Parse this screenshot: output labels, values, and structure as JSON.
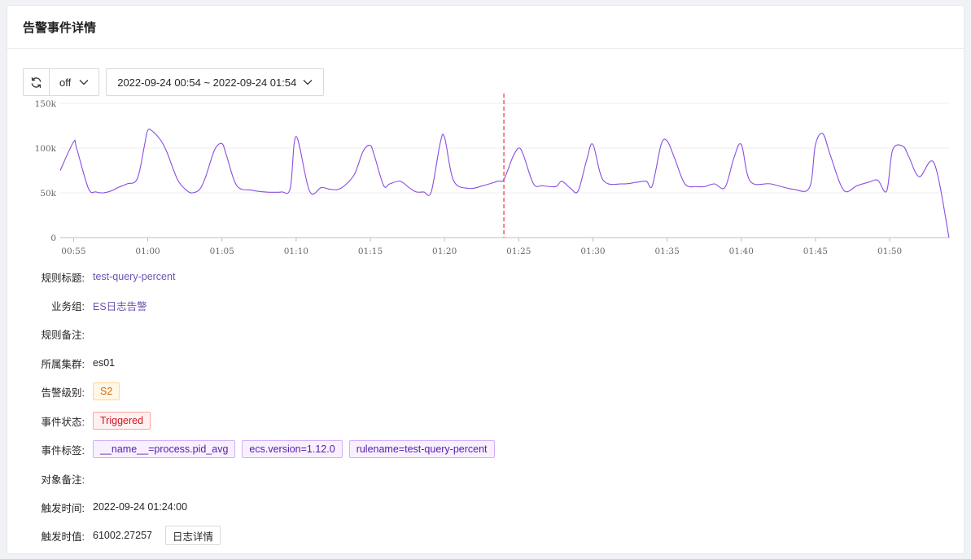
{
  "header": {
    "title": "告警事件详情"
  },
  "toolbar": {
    "refresh_icon": "refresh-icon",
    "refresh_interval": "off",
    "time_range": "2022-09-24 00:54 ~ 2022-09-24 01:54"
  },
  "chart_data": {
    "type": "line",
    "ylim": [
      0,
      150000
    ],
    "y_ticks": [
      0,
      50000,
      100000,
      150000
    ],
    "y_tick_labels": [
      "0",
      "50k",
      "100k",
      "150k"
    ],
    "x_tick_labels": [
      "00:55",
      "01:00",
      "01:05",
      "01:10",
      "01:15",
      "01:20",
      "01:25",
      "01:30",
      "01:35",
      "01:40",
      "01:45",
      "01:50"
    ],
    "x_tick_minutes": [
      55,
      60,
      65,
      70,
      75,
      80,
      85,
      90,
      95,
      100,
      105,
      110
    ],
    "xlim_minutes": [
      54.1,
      114.0
    ],
    "trigger_marker_minutes": 84.0,
    "grid": true,
    "series": [
      {
        "color": "#8a4de0",
        "x": [
          54.1,
          55.0,
          55.2,
          56.0,
          56.5,
          57.0,
          57.5,
          58.0,
          58.6,
          59.3,
          59.8,
          60.0,
          60.3,
          60.9,
          61.3,
          62.0,
          62.6,
          63.0,
          63.5,
          63.9,
          64.5,
          65.0,
          65.3,
          66.0,
          67.0,
          67.9,
          69.0,
          69.6,
          70.0,
          70.9,
          71.7,
          72.3,
          73.0,
          73.9,
          74.5,
          75.0,
          75.3,
          75.9,
          76.3,
          77.0,
          77.6,
          78.1,
          78.6,
          79.1,
          79.7,
          80.0,
          80.6,
          81.6,
          82.6,
          83.6,
          84.0,
          84.6,
          85.0,
          85.3,
          86.0,
          86.6,
          87.5,
          87.9,
          88.5,
          89.0,
          89.6,
          90.0,
          90.7,
          92.0,
          93.0,
          93.6,
          94.0,
          94.6,
          95.0,
          95.5,
          96.2,
          97.0,
          97.5,
          98.2,
          98.9,
          99.5,
          100.0,
          100.6,
          102.0,
          103.5,
          104.6,
          105.0,
          105.5,
          106.0,
          106.9,
          107.8,
          108.6,
          109.2,
          109.8,
          110.2,
          110.9,
          111.3,
          112.0,
          113.0,
          114.0
        ],
        "y": [
          75000,
          107000,
          100000,
          55000,
          51000,
          50000,
          52000,
          56000,
          60000,
          66000,
          105000,
          120000,
          119000,
          108000,
          95000,
          65000,
          53000,
          50000,
          54000,
          68000,
          98000,
          105000,
          92000,
          58000,
          53000,
          51000,
          51000,
          55000,
          113000,
          52000,
          56000,
          54000,
          55000,
          70000,
          96000,
          103000,
          90000,
          58000,
          60000,
          63000,
          56000,
          51000,
          51000,
          51000,
          105000,
          112000,
          64000,
          55000,
          58000,
          63000,
          65000,
          90000,
          100000,
          93000,
          60000,
          58000,
          57000,
          63000,
          55000,
          52000,
          88000,
          104000,
          64000,
          60000,
          62000,
          63000,
          58000,
          104000,
          108000,
          89000,
          60000,
          57000,
          57000,
          60000,
          56000,
          89000,
          104000,
          63000,
          60000,
          54000,
          56000,
          104000,
          116000,
          92000,
          53000,
          58000,
          62000,
          64000,
          52000,
          98000,
          102000,
          90000,
          68000,
          83000,
          0
        ]
      }
    ]
  },
  "details": {
    "rule_title_label": "规则标题:",
    "rule_title": "test-query-percent",
    "business_group_label": "业务组:",
    "business_group": "ES日志告警",
    "rule_note_label": "规则备注:",
    "cluster_label": "所属集群:",
    "cluster": "es01",
    "severity_label": "告警级别:",
    "severity": "S2",
    "status_label": "事件状态:",
    "status": "Triggered",
    "tags_label": "事件标签:",
    "tags": [
      "__name__=process.pid_avg",
      "ecs.version=1.12.0",
      "rulename=test-query-percent"
    ],
    "target_note_label": "对象备注:",
    "trigger_time_label": "触发时间:",
    "trigger_time": "2022-09-24 01:24:00",
    "trigger_value_label": "触发时值:",
    "trigger_value": "61002.27257",
    "log_detail_button": "日志详情"
  }
}
